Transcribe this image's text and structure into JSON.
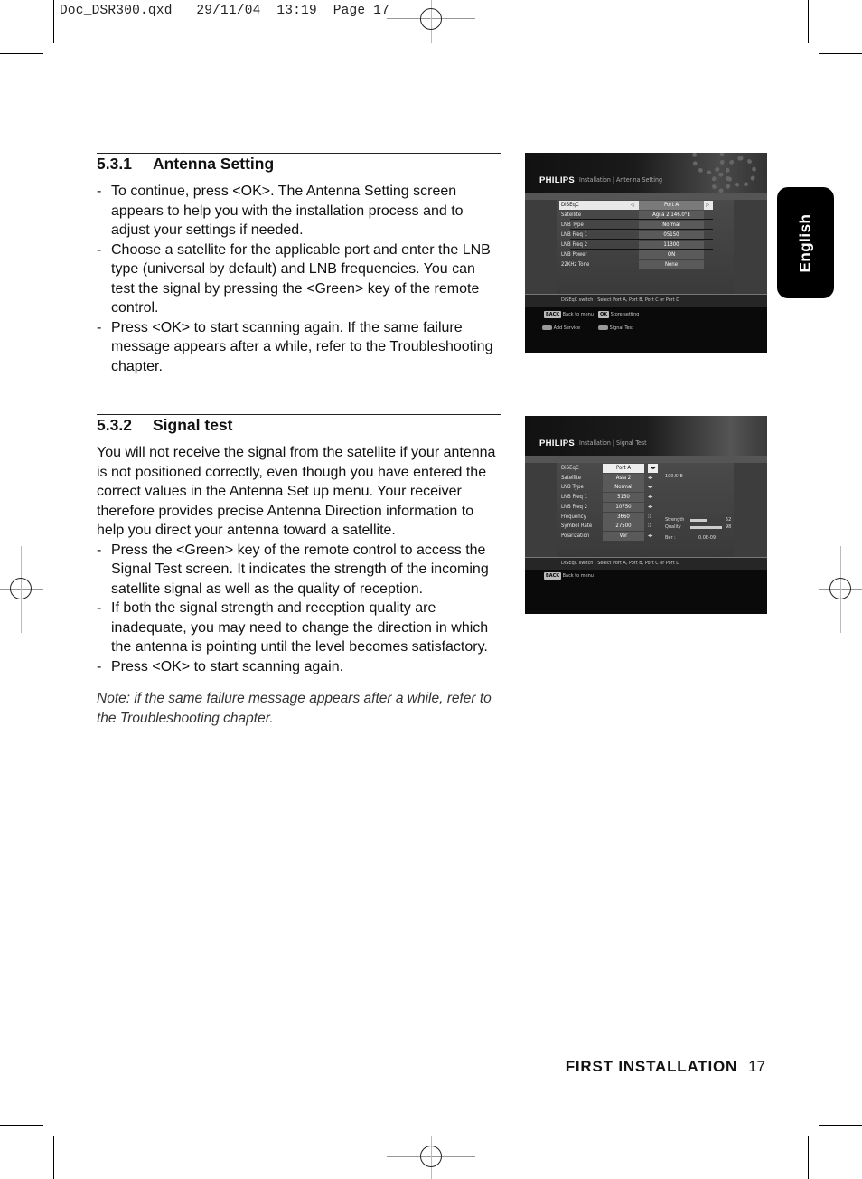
{
  "slug": {
    "filename": "Doc_DSR300.qxd",
    "date": "29/11/04",
    "time": "13:19",
    "page_label": "Page 17"
  },
  "sections": [
    {
      "number": "5.3.1",
      "title": "Antenna Setting",
      "bullets": [
        "To continue, press <OK>. The Antenna Setting screen appears to help you with the installation process and to adjust your settings if needed.",
        "Choose a satellite for the applicable port and enter the LNB type (universal by default) and LNB frequencies. You can test the signal by pressing the <Green> key of the remote control.",
        "Press <OK> to start scanning again. If the same failure message appears after a while, refer to the Troubleshooting chapter."
      ]
    },
    {
      "number": "5.3.2",
      "title": "Signal test",
      "intro": "You will not receive the signal from the satellite if your antenna is not positioned correctly, even though you have entered the correct values in the Antenna Set up menu. Your receiver therefore provides precise Antenna Direction information to help you direct your antenna toward a satellite.",
      "bullets": [
        "Press the <Green> key of the remote control to access the Signal Test screen. It indicates the strength of the incoming satellite signal as well as the quality of reception.",
        "If both the signal strength and reception quality are inadequate, you may need to change the direction in which the antenna is pointing until the level becomes satisfactory.",
        "Press <OK> to start scanning again."
      ],
      "note": "Note: if the same failure message appears after a while, refer to the Troubleshooting chapter."
    }
  ],
  "bullet_dash": "-",
  "language_tab": "English",
  "footer": {
    "section": "FIRST INSTALLATION",
    "page": "17"
  },
  "screens": {
    "antenna": {
      "brand": "PHILIPS",
      "breadcrumb": "Installation | Antenna Setting",
      "rows": [
        {
          "label": "DiSEqC",
          "value": "Port A"
        },
        {
          "label": "Satellite",
          "value": "Agila 2 146.0°E"
        },
        {
          "label": "LNB Type",
          "value": "Normal"
        },
        {
          "label": "LNB Freq 1",
          "value": "05150"
        },
        {
          "label": "LNB Freq 2",
          "value": "11300"
        },
        {
          "label": "LNB Power",
          "value": "ON"
        },
        {
          "label": "22KHz Tone",
          "value": "None"
        }
      ],
      "arrow_left": "◁",
      "arrow_right": "▷",
      "hint": "DiSEqC switch : Select Port A, Port B, Port C or Port D",
      "footer": {
        "back_key": "BACK",
        "back_label": "Back to menu",
        "ok_key": "OK",
        "ok_label": "Store setting",
        "add_service": "Add Service",
        "signal_test": "Signal Test"
      }
    },
    "signal": {
      "brand": "PHILIPS",
      "breadcrumb": "Installation | Signal Test",
      "rows": [
        {
          "label": "DiSEqC",
          "value": "Port A"
        },
        {
          "label": "Satellite",
          "value": "Asia 2"
        },
        {
          "label": "LNB Type",
          "value": "Normal"
        },
        {
          "label": "LNB Freq 1",
          "value": "5150"
        },
        {
          "label": "LNB Freq 2",
          "value": "10750"
        },
        {
          "label": "Frequency",
          "value": "3660"
        },
        {
          "label": "Symbol Rate",
          "value": "27500"
        },
        {
          "label": "Polarization",
          "value": "Ver"
        }
      ],
      "arrow": "◂▸",
      "num_icon": "⁝⁝",
      "position": "100.5°E",
      "strength_label": "Strength",
      "strength_value": "52",
      "strength_fraction": 0.52,
      "quality_label": "Quality",
      "quality_value": "98",
      "quality_fraction": 0.98,
      "ber_label": "Ber :",
      "ber_value": "0.0E-09",
      "hint": "DiSEqC switch : Select Port A, Port B, Port C or Port D",
      "footer": {
        "back_key": "BACK",
        "back_label": "Back to menu"
      }
    }
  }
}
